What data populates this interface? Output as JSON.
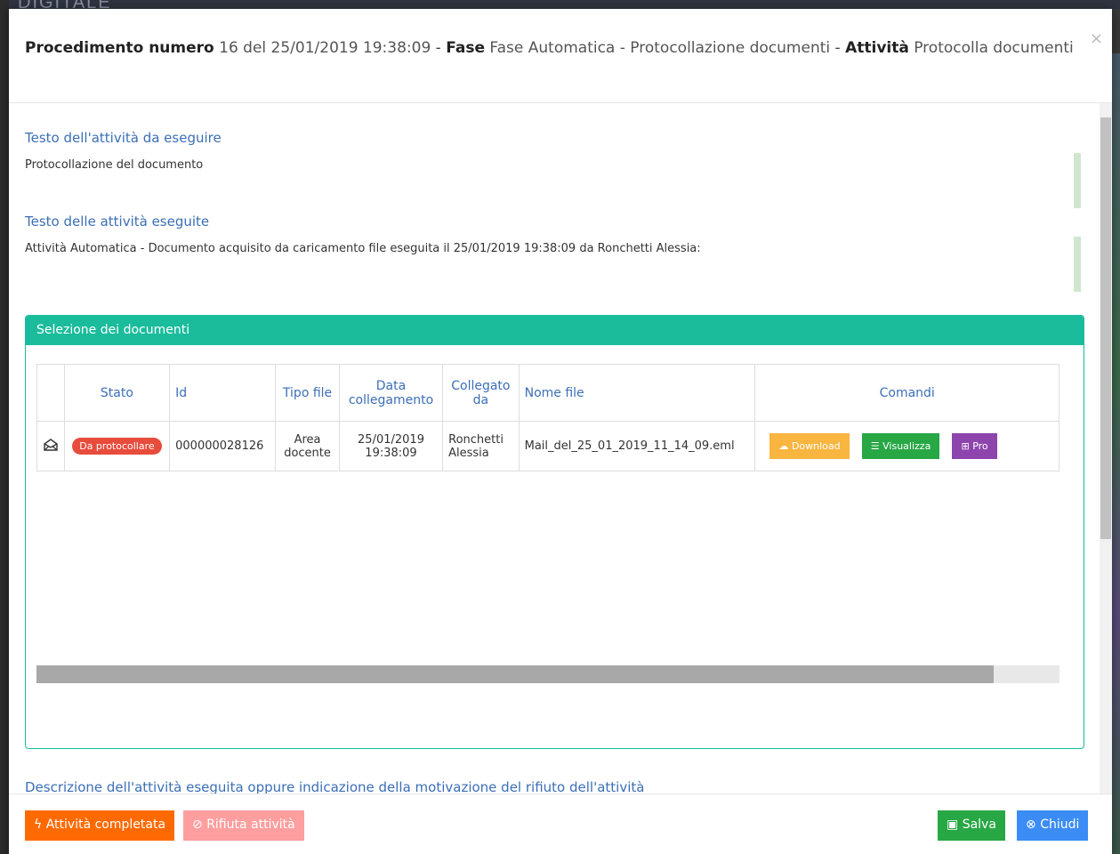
{
  "backdrop": {
    "logo_text": "DIGITALE"
  },
  "header": {
    "label_procedimento": "Procedimento numero",
    "procedimento_value": "16 del 25/01/2019 19:38:09",
    "sep1": " - ",
    "label_fase": "Fase",
    "fase_value": "Fase Automatica - Protocollazione documenti",
    "sep2": " - ",
    "label_attivita": "Attività",
    "attivita_value": "Protocolla documenti",
    "close_glyph": "×"
  },
  "sections": {
    "todo_title": "Testo dell'attività da eseguire",
    "todo_text": "Protocollazione del documento",
    "done_title": "Testo delle attività eseguite",
    "done_text": "Attività Automatica - Documento acquisito da caricamento file eseguita il 25/01/2019 19:38:09 da Ronchetti Alessia:",
    "description_title": "Descrizione dell'attività eseguita oppure indicazione della motivazione del rifiuto dell'attività"
  },
  "panel": {
    "title": "Selezione dei documenti",
    "columns": {
      "stato": "Stato",
      "id": "Id",
      "tipo_file": "Tipo file",
      "data_collegamento": "Data collegamento",
      "collegato_da": "Collegato da",
      "nome_file": "Nome file",
      "comandi": "Comandi"
    },
    "rows": [
      {
        "icon": "envelope-open-icon",
        "stato": "Da protocollare",
        "id": "000000028126",
        "tipo_file": "Area docente",
        "data_collegamento": "25/01/2019 19:38:09",
        "collegato_da": "Ronchetti Alessia",
        "nome_file": "Mail_del_25_01_2019_11_14_09.eml",
        "btn_download": "Download",
        "btn_visualizza": "Visualizza",
        "btn_pro": "Pro"
      }
    ]
  },
  "footer": {
    "complete_label": "Attività completata",
    "reject_label": "Rifiuta attività",
    "save_label": "Salva",
    "close_label": "Chiudi"
  },
  "colors": {
    "panel_accent": "#1abc9c",
    "title_blue": "#3b6fb6",
    "badge_red": "#e74c3c",
    "download_orange": "#f8b53f",
    "visualizza_green": "#28a745",
    "pro_purple": "#8e44ad",
    "complete_orange": "#ff6a00",
    "reject_pink": "#ff9e9e",
    "close_blue": "#3b8cf5"
  }
}
